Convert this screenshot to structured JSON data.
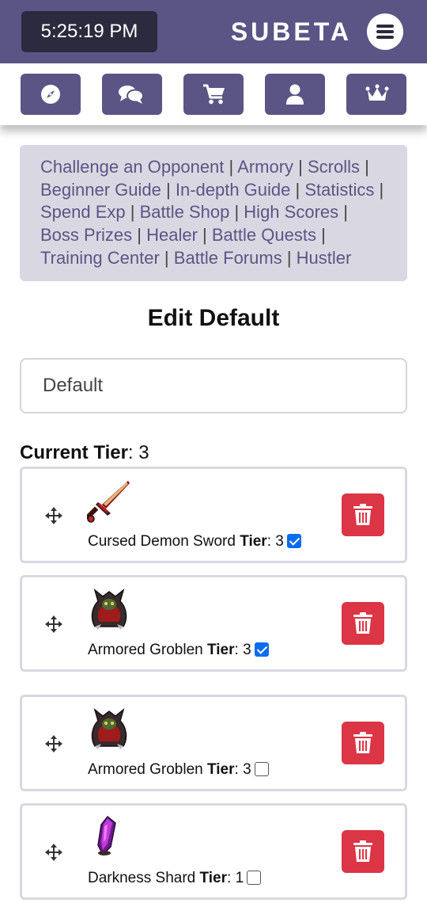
{
  "header": {
    "clock": "5:25:19 PM",
    "brand": "SUBETA",
    "menu_icon": "hamburger-icon",
    "nav": [
      {
        "icon": "compass-icon",
        "label": "Explore"
      },
      {
        "icon": "chat-icon",
        "label": "Chat"
      },
      {
        "icon": "cart-icon",
        "label": "Shops"
      },
      {
        "icon": "user-icon",
        "label": "Profile"
      },
      {
        "icon": "crown-icon",
        "label": "Premium"
      }
    ]
  },
  "battle_links": [
    "Challenge an Opponent",
    "Armory",
    "Scrolls",
    "Beginner Guide",
    "In-depth Guide",
    "Statistics",
    "Spend Exp",
    "Battle Shop",
    "High Scores",
    "Boss Prizes",
    "Healer",
    "Battle Quests",
    "Training Center",
    "Battle Forums",
    "Hustler"
  ],
  "edit": {
    "title": "Edit Default",
    "name_value": "Default",
    "current_tier_label": "Current Tier",
    "current_tier_sep": ":",
    "current_tier_value": "3"
  },
  "tier_word": "Tier",
  "items": [
    {
      "name": "Cursed Demon Sword",
      "tier": "3",
      "checked": true,
      "icon": "sword-icon"
    },
    {
      "name": "Armored Groblen",
      "tier": "3",
      "checked": true,
      "icon": "groblen-icon"
    },
    {
      "name": "Armored Groblen",
      "tier": "3",
      "checked": false,
      "icon": "groblen-icon"
    },
    {
      "name": "Darkness Shard",
      "tier": "1",
      "checked": false,
      "icon": "shard-icon"
    }
  ],
  "colors": {
    "brand_purple": "#5a5585",
    "clock_bg": "#2b2a3e",
    "links_bg": "#d9d8e2",
    "delete_red": "#dc3545",
    "checkbox_blue": "#0b6cf0"
  }
}
